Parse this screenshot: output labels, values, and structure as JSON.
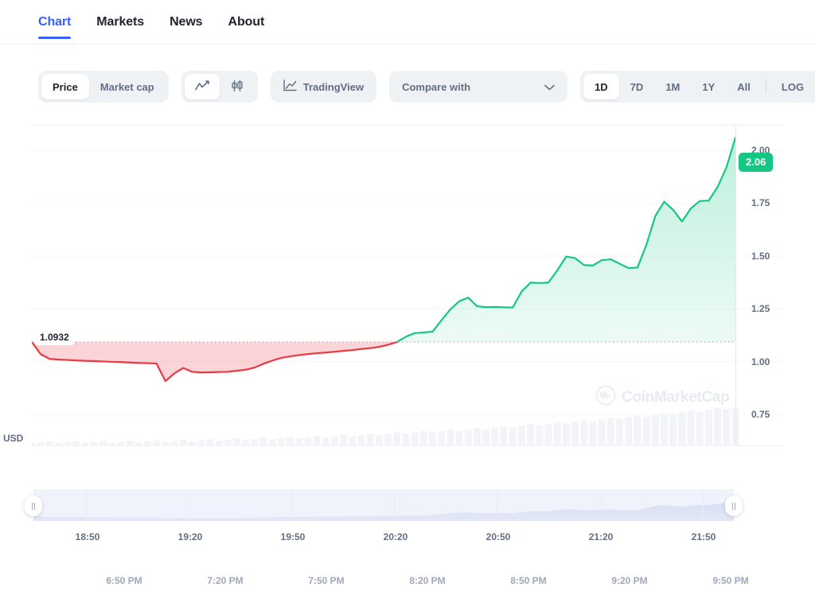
{
  "tabs": [
    {
      "label": "Chart",
      "active": true
    },
    {
      "label": "Markets",
      "active": false
    },
    {
      "label": "News",
      "active": false
    },
    {
      "label": "About",
      "active": false
    }
  ],
  "toolbar": {
    "metric": {
      "price": "Price",
      "market_cap": "Market cap",
      "selected": "Price"
    },
    "chart_type": {
      "line_icon": "line-chart-icon",
      "candles_icon": "candlestick-icon",
      "selected": "line"
    },
    "tradingview": {
      "label": "TradingView",
      "icon": "tradingview-icon"
    },
    "compare": {
      "label": "Compare with",
      "chevron": "chevron-down-icon"
    },
    "ranges": {
      "items": [
        "1D",
        "7D",
        "1M",
        "1Y",
        "All"
      ],
      "selected": "1D",
      "log": "LOG",
      "more": "···"
    }
  },
  "chart_data": {
    "type": "area",
    "title": "",
    "xlabel": "",
    "ylabel": "USD",
    "currency_label": "USD",
    "ylim": [
      0.6,
      2.12
    ],
    "yticks": [
      2.0,
      1.75,
      1.5,
      1.25,
      1.0,
      0.75
    ],
    "ytick_labels": [
      "2.00",
      "1.75",
      "1.50",
      "1.25",
      "1.00",
      "0.75"
    ],
    "grid": true,
    "legend": false,
    "baseline": 1.0932,
    "baseline_label": "1.0932",
    "last_price": 2.06,
    "last_price_label": "2.06",
    "watermark": "CoinMarketCap",
    "xtick_labels": [
      "6:50 PM",
      "7:20 PM",
      "7:50 PM",
      "8:20 PM",
      "8:50 PM",
      "9:20 PM",
      "9:50 PM"
    ],
    "colors": {
      "up": "#16c784",
      "down": "#ea3943",
      "badge": "#16c784",
      "grid": "#f4f6f9",
      "volume": "#f2f4f8"
    },
    "series": [
      {
        "name": "Price",
        "values": [
          1.093,
          1.035,
          1.013,
          1.01,
          1.008,
          1.006,
          1.004,
          1.003,
          1.001,
          0.999,
          0.998,
          0.996,
          0.994,
          0.993,
          0.991,
          0.908,
          0.945,
          0.97,
          0.952,
          0.949,
          0.95,
          0.951,
          0.952,
          0.957,
          0.962,
          0.972,
          0.99,
          1.005,
          1.018,
          1.025,
          1.031,
          1.036,
          1.04,
          1.043,
          1.047,
          1.051,
          1.055,
          1.06,
          1.064,
          1.07,
          1.08,
          1.093,
          1.118,
          1.135,
          1.138,
          1.142,
          1.196,
          1.248,
          1.286,
          1.303,
          1.262,
          1.258,
          1.259,
          1.257,
          1.256,
          1.332,
          1.374,
          1.372,
          1.374,
          1.432,
          1.497,
          1.49,
          1.457,
          1.455,
          1.48,
          1.484,
          1.463,
          1.443,
          1.445,
          1.552,
          1.688,
          1.757,
          1.718,
          1.663,
          1.725,
          1.76,
          1.762,
          1.826,
          1.92,
          2.06
        ]
      }
    ],
    "volume_note": "volume bars increasing left to right"
  },
  "navigator": {
    "xtick_labels": [
      "18:50",
      "19:20",
      "19:50",
      "20:20",
      "20:50",
      "21:20",
      "21:50"
    ],
    "left_handle": "navigator-left-handle",
    "right_handle": "navigator-right-handle"
  }
}
